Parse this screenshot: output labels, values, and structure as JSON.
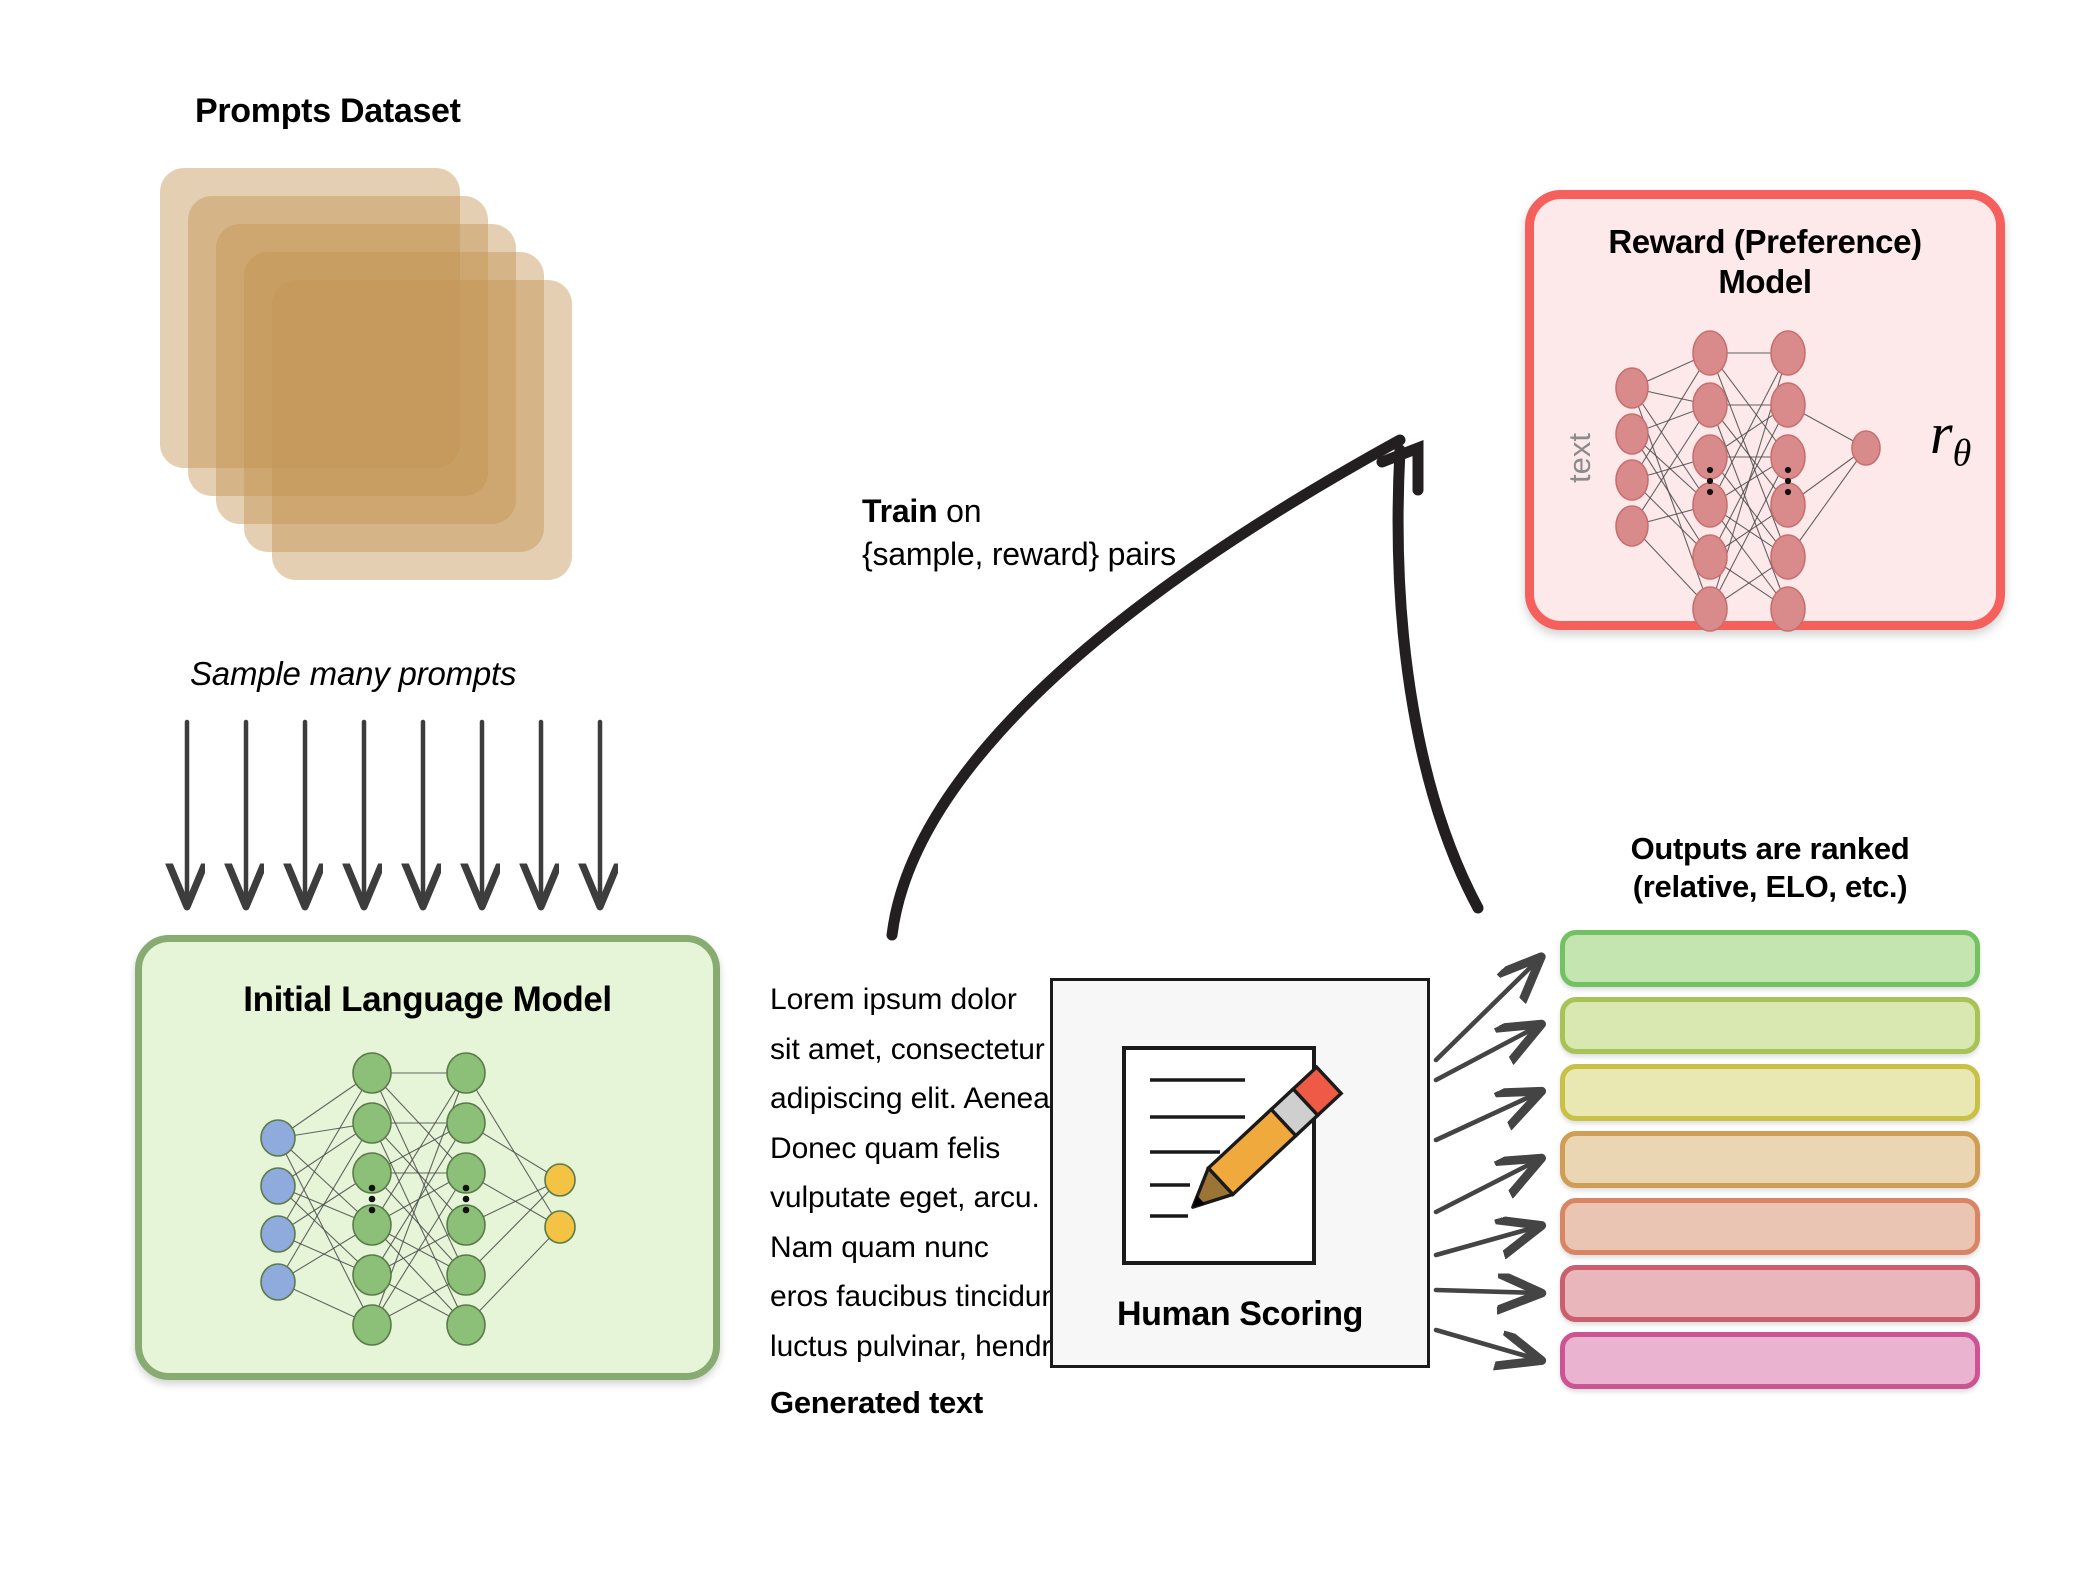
{
  "prompts": {
    "title": "Prompts Dataset",
    "sample_label": "Sample many prompts",
    "card_color": "#c49455",
    "card_count": 5,
    "arrow_count": 8
  },
  "initial_model": {
    "title": "Initial Language Model",
    "box_fill": "#e6f5d8",
    "box_border": "#87ab71",
    "input_node_color": "#8fabdd",
    "hidden_node_color": "#8cbf77",
    "output_node_color": "#f5c343",
    "input_nodes": 4,
    "hidden_layers": 2,
    "output_nodes": 2
  },
  "reward_model": {
    "title": "Reward (Preference) Model",
    "text_label": "text",
    "output_symbol": "r",
    "output_subscript": "θ",
    "box_fill": "#fde9ea",
    "box_border": "#f5605c",
    "node_color": "#d98b8b",
    "input_nodes": 4,
    "hidden_layers": 2,
    "output_nodes": 1
  },
  "train_arrow": {
    "bold_word": "Train",
    "rest_line1": " on",
    "line2": "{sample, reward} pairs"
  },
  "generated_text": {
    "label": "Generated text",
    "lines": [
      "Lorem ipsum dolor",
      "sit amet, consectetur",
      "adipiscing elit. Aenean",
      "Donec quam felis",
      "vulputate eget, arcu.",
      "Nam quam nunc",
      "eros faucibus tincidunt",
      "luctus pulvinar, hendrerit"
    ]
  },
  "human_scoring": {
    "title": "Human Scoring",
    "icon": "document-pencil-icon",
    "box_fill": "#f7f7f7",
    "box_border": "#1a1a1a",
    "pencil_body_color": "#f0a93c",
    "pencil_eraser_color": "#ef5a47",
    "pencil_ferrule_color": "#cfcfcf",
    "pencil_wood_color": "#9c7436",
    "doc_line_count": 5
  },
  "outputs_ranked": {
    "title_line1": "Outputs are ranked",
    "title_line2": "(relative, ELO, etc.)",
    "bars": [
      {
        "rank": 1,
        "fill": "#c5e5b0",
        "border": "#73c163"
      },
      {
        "rank": 2,
        "fill": "#d9e7b0",
        "border": "#a8c255"
      },
      {
        "rank": 3,
        "fill": "#e9e7b2",
        "border": "#c9c046"
      },
      {
        "rank": 4,
        "fill": "#ebd6b3",
        "border": "#cf9e54"
      },
      {
        "rank": 5,
        "fill": "#ebc5b4",
        "border": "#d98564"
      },
      {
        "rank": 6,
        "fill": "#e9b6bc",
        "border": "#cc5f6d"
      },
      {
        "rank": 7,
        "fill": "#eab4d0",
        "border": "#cc5494"
      }
    ],
    "arrow_count": 7
  }
}
